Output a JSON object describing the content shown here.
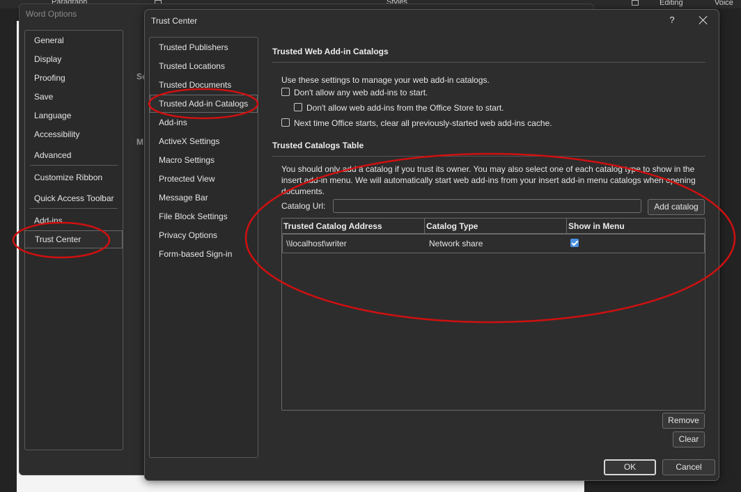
{
  "ribbon": {
    "paragraph_label": "Paragraph",
    "styles_label": "Styles",
    "editing_label": "Editing",
    "voice_label": "Voice"
  },
  "word_options": {
    "title": "Word Options",
    "nav": [
      {
        "label": "General"
      },
      {
        "label": "Display"
      },
      {
        "label": "Proofing"
      },
      {
        "label": "Save"
      },
      {
        "label": "Language"
      },
      {
        "label": "Accessibility"
      },
      {
        "label": "Advanced"
      },
      {
        "label": "Customize Ribbon"
      },
      {
        "label": "Quick Access Toolbar"
      },
      {
        "label": "Add-ins"
      },
      {
        "label": "Trust Center",
        "selected": true
      }
    ],
    "hidden_fragments": [
      "Se",
      "M"
    ]
  },
  "trust_center": {
    "title": "Trust Center",
    "help_glyph": "?",
    "nav": [
      {
        "label": "Trusted Publishers"
      },
      {
        "label": "Trusted Locations"
      },
      {
        "label": "Trusted Documents"
      },
      {
        "label": "Trusted Add-in Catalogs",
        "selected": true
      },
      {
        "label": "Add-ins"
      },
      {
        "label": "ActiveX Settings"
      },
      {
        "label": "Macro Settings"
      },
      {
        "label": "Protected View"
      },
      {
        "label": "Message Bar"
      },
      {
        "label": "File Block Settings"
      },
      {
        "label": "Privacy Options"
      },
      {
        "label": "Form-based Sign-in"
      }
    ],
    "web_catalogs": {
      "heading": "Trusted Web Add-in Catalogs",
      "intro": "Use these settings to manage your web add-in catalogs.",
      "opt1": {
        "label": "Don't allow any web add-ins to start.",
        "checked": false
      },
      "opt2": {
        "label": "Don't allow web add-ins from the Office Store to start.",
        "checked": false
      },
      "opt3": {
        "label": "Next time Office starts, clear all previously-started web add-ins cache.",
        "checked": false
      }
    },
    "catalogs_table": {
      "heading": "Trusted Catalogs Table",
      "description": "You should only add a catalog if you trust its owner. You may also select one of each catalog type to show in the insert add-in menu. We will automatically start web add-ins from your insert add-in menu catalogs when opening documents.",
      "catalog_url_label": "Catalog Url:",
      "catalog_url_value": "",
      "add_button": "Add catalog",
      "columns": [
        "Trusted Catalog Address",
        "Catalog Type",
        "Show in Menu"
      ],
      "rows": [
        {
          "address": "\\\\localhost\\writer",
          "type": "Network share",
          "show_in_menu": true
        }
      ],
      "remove_button": "Remove",
      "clear_button": "Clear"
    },
    "ok_button": "OK",
    "cancel_button": "Cancel"
  },
  "annotation_color": "#d01010"
}
